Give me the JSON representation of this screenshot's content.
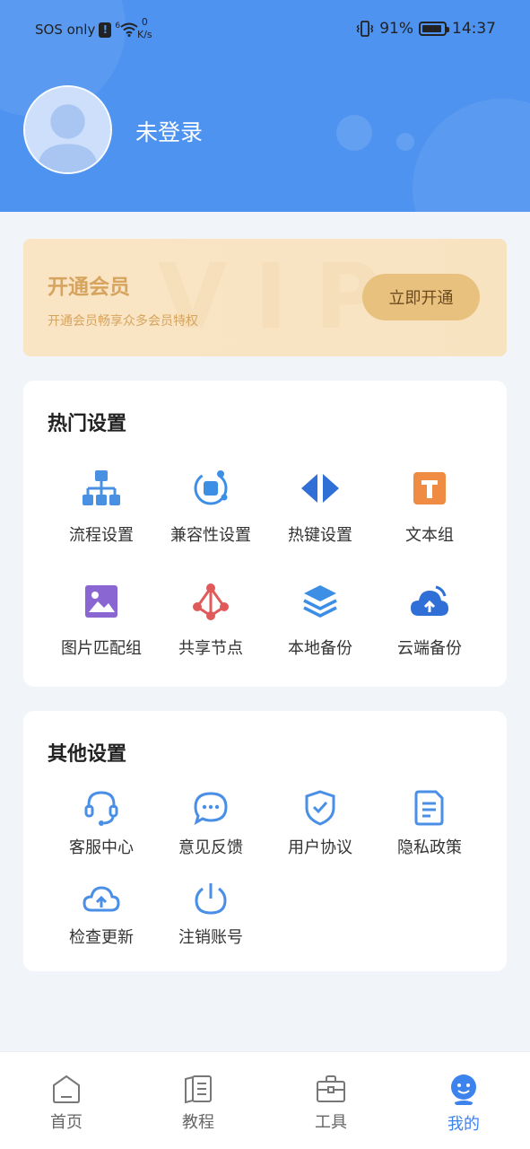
{
  "status_bar": {
    "carrier": "SOS only",
    "alert": "!",
    "signal_tag": "6",
    "speed_value": "0",
    "speed_unit": "K/s",
    "battery": "91%",
    "battery_level": 0.91,
    "time": "14:37"
  },
  "profile": {
    "username": "未登录"
  },
  "vip": {
    "watermark": "VIP",
    "title": "开通会员",
    "subtitle": "开通会员畅享众多会员特权",
    "button": "立即开通"
  },
  "hot_settings": {
    "title": "热门设置",
    "items": [
      {
        "label": "流程设置",
        "icon": "flowchart-icon",
        "color": "#4a90e2"
      },
      {
        "label": "兼容性设置",
        "icon": "compatibility-icon",
        "color": "#3d8fe6"
      },
      {
        "label": "热键设置",
        "icon": "hotkey-icon",
        "color": "#2f6fd6"
      },
      {
        "label": "文本组",
        "icon": "text-group-icon",
        "color": "#ef8b43"
      },
      {
        "label": "图片匹配组",
        "icon": "image-match-icon",
        "color": "#8a66d3"
      },
      {
        "label": "共享节点",
        "icon": "share-node-icon",
        "color": "#e05a5a"
      },
      {
        "label": "本地备份",
        "icon": "local-backup-icon",
        "color": "#3d8fe6"
      },
      {
        "label": "云端备份",
        "icon": "cloud-backup-icon",
        "color": "#2f6fd6"
      }
    ]
  },
  "other_settings": {
    "title": "其他设置",
    "items": [
      {
        "label": "客服中心",
        "icon": "headset-icon"
      },
      {
        "label": "意见反馈",
        "icon": "feedback-icon"
      },
      {
        "label": "用户协议",
        "icon": "shield-check-icon"
      },
      {
        "label": "隐私政策",
        "icon": "document-icon"
      },
      {
        "label": "检查更新",
        "icon": "cloud-upload-icon"
      },
      {
        "label": "注销账号",
        "icon": "power-icon"
      }
    ]
  },
  "tabbar": {
    "tabs": [
      {
        "label": "首页",
        "icon": "home-icon"
      },
      {
        "label": "教程",
        "icon": "book-icon"
      },
      {
        "label": "工具",
        "icon": "toolbox-icon"
      },
      {
        "label": "我的",
        "icon": "profile-face-icon",
        "active": true
      }
    ]
  },
  "colors": {
    "header_bg": "#4e93f0",
    "page_bg": "#f1f4f8",
    "vip_text": "#d7a45f",
    "vip_button": "#e9c17f",
    "accent": "#3c83ee",
    "outline_icon": "#4a8fe7"
  }
}
